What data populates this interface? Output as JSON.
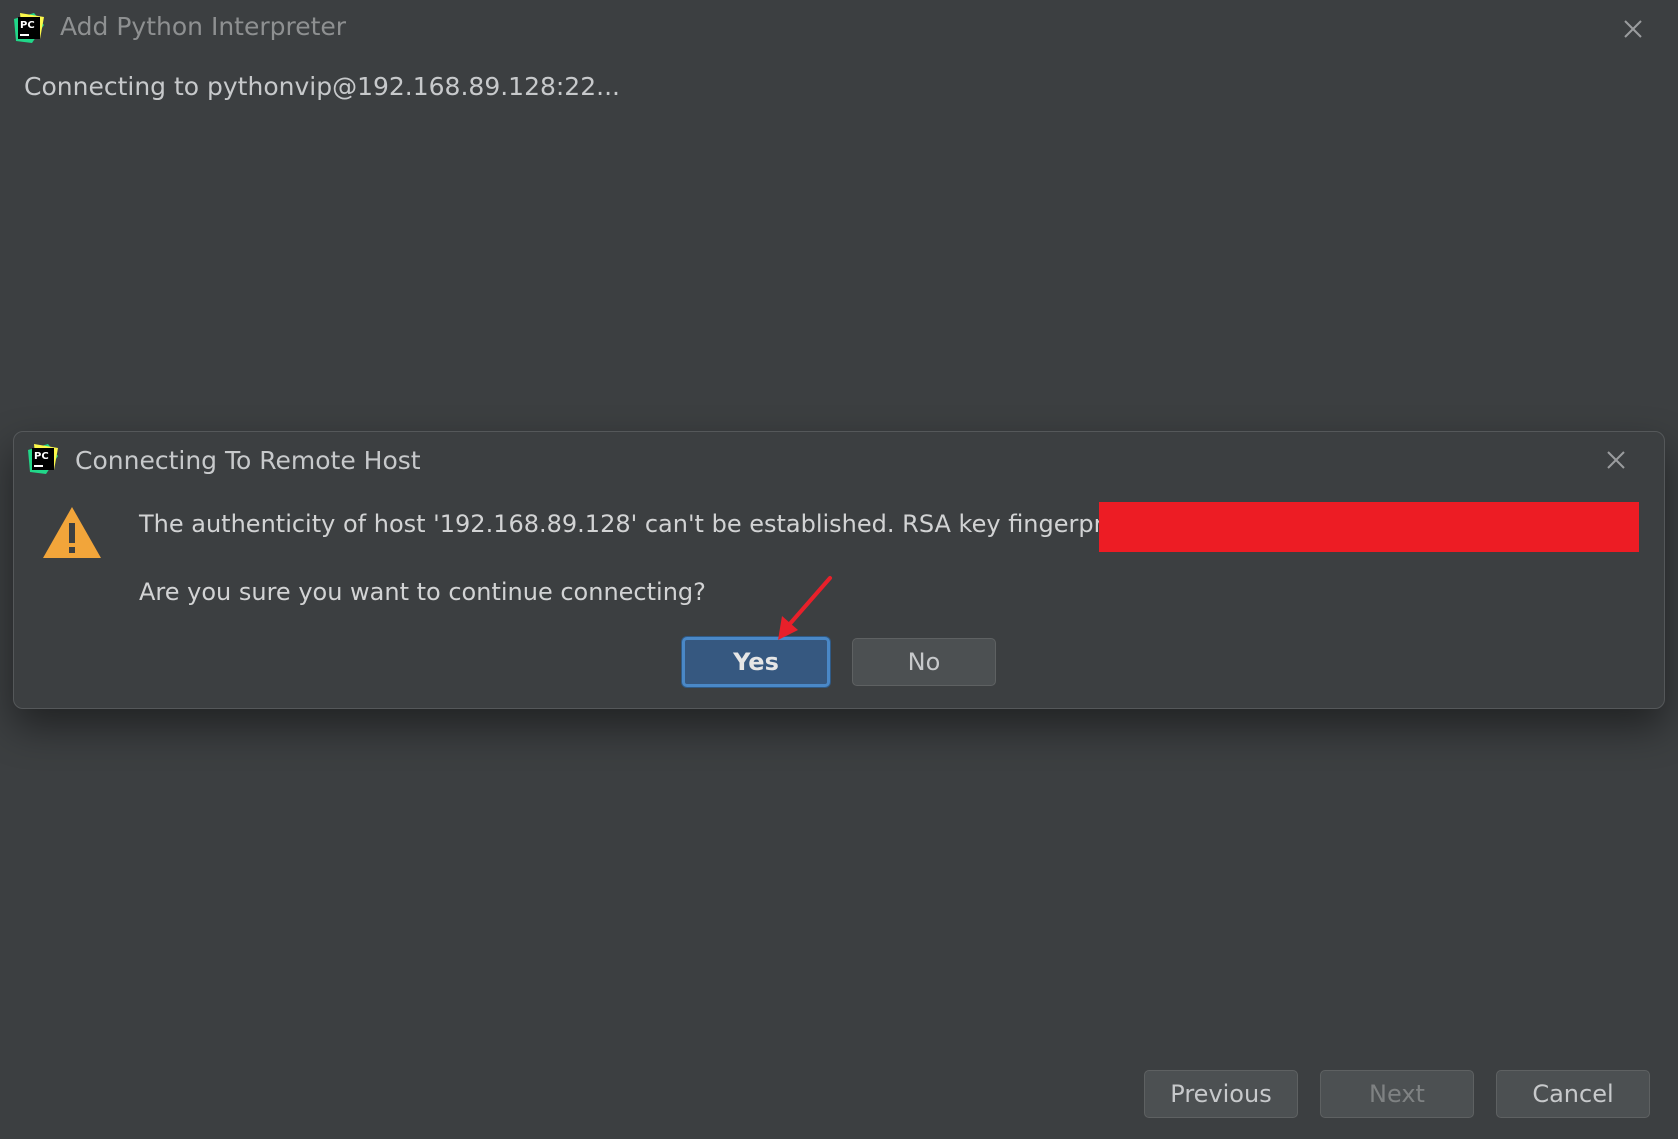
{
  "window": {
    "title": "Add Python Interpreter",
    "status": "Connecting to pythonvip@192.168.89.128:22..."
  },
  "dialog": {
    "title": "Connecting To Remote Host",
    "message": "The authenticity of host '192.168.89.128' can't be established. RSA key fingerprint is",
    "question": "Are you sure you want to continue connecting?",
    "yes_label": "Yes",
    "no_label": "No"
  },
  "footer": {
    "previous_label": "Previous",
    "next_label": "Next",
    "cancel_label": "Cancel"
  },
  "icons": {
    "app_logo": "pycharm-logo-icon",
    "close": "close-icon",
    "warning": "warning-icon",
    "annotation": "red-arrow-icon"
  },
  "colors": {
    "background": "#3c3f41",
    "default_button": "#365880",
    "default_button_border": "#4a88c7",
    "warning": "#f2a53a",
    "redaction": "#ed1c24",
    "annotation_arrow": "#e8202a"
  }
}
